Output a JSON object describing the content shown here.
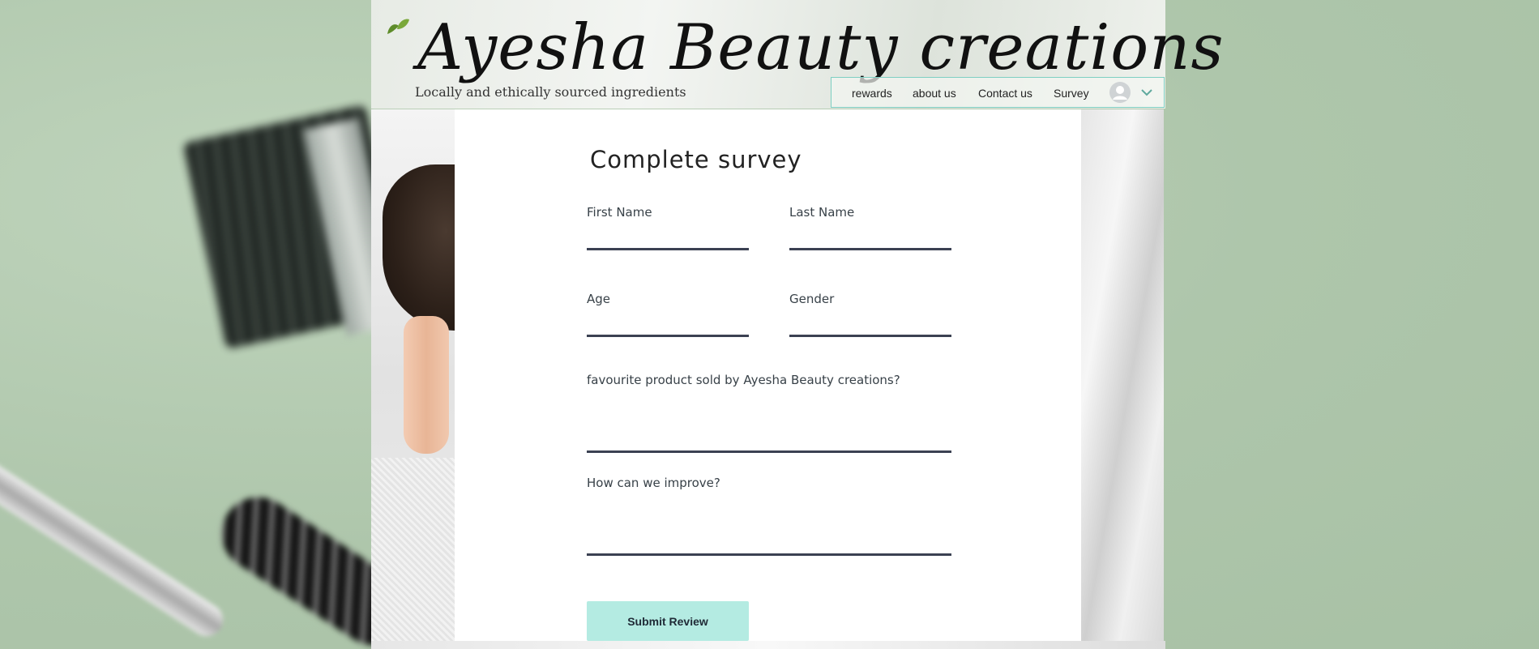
{
  "header": {
    "brand": "Ayesha Beauty creations",
    "tagline": "Locally and ethically sourced ingredients"
  },
  "nav": {
    "items": [
      "rewards",
      "about us",
      "Contact us",
      "Survey"
    ],
    "account_icon": "user-avatar-icon",
    "dropdown_icon": "chevron-down-icon"
  },
  "form": {
    "title": "Complete survey",
    "first_name": {
      "label": "First Name",
      "value": ""
    },
    "last_name": {
      "label": "Last Name",
      "value": ""
    },
    "age": {
      "label": "Age",
      "value": ""
    },
    "gender": {
      "label": "Gender",
      "value": ""
    },
    "favourite": {
      "label": "favourite product sold by Ayesha Beauty creations?",
      "value": ""
    },
    "improve": {
      "label": "How can we improve?",
      "value": ""
    },
    "submit_label": "Submit Review"
  },
  "colors": {
    "accent": "#b4ebe2",
    "nav_border": "#7ecfc2",
    "field_underline": "#3b4152",
    "background_green": "#b4cab1"
  }
}
